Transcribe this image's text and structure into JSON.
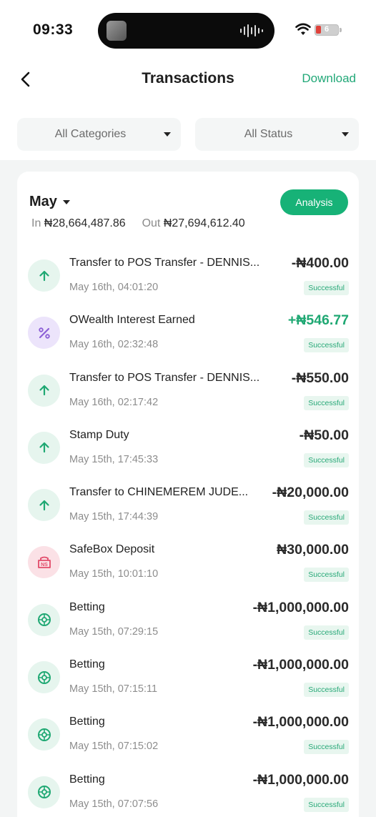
{
  "status_bar": {
    "time": "09:33",
    "battery": "6"
  },
  "nav": {
    "title": "Transactions",
    "download": "Download"
  },
  "filters": {
    "category": "All Categories",
    "status": "All Status"
  },
  "summary": {
    "month": "May",
    "in_label": "In",
    "in_value": "₦28,664,487.86",
    "out_label": "Out",
    "out_value": "₦27,694,612.40",
    "analysis": "Analysis"
  },
  "colors": {
    "accent": "#17b277",
    "positive": "#1fa873",
    "icon_green": "#1fa873",
    "icon_purple": "#8b5fd6",
    "icon_red": "#e24b6a"
  },
  "transactions": [
    {
      "icon": "arrow-up-icon",
      "kind": "out",
      "title": "Transfer to POS Transfer - DENNIS...",
      "date": "May 16th, 04:01:20",
      "amount": "-₦400.00",
      "positive": false,
      "status": "Successful"
    },
    {
      "icon": "percent-icon",
      "kind": "interest",
      "title": "OWealth Interest Earned",
      "date": "May 16th, 02:32:48",
      "amount": "+₦546.77",
      "positive": true,
      "status": "Successful"
    },
    {
      "icon": "arrow-up-icon",
      "kind": "out",
      "title": "Transfer to POS Transfer - DENNIS...",
      "date": "May 16th, 02:17:42",
      "amount": "-₦550.00",
      "positive": false,
      "status": "Successful"
    },
    {
      "icon": "arrow-up-icon",
      "kind": "out",
      "title": "Stamp Duty",
      "date": "May 15th, 17:45:33",
      "amount": "-₦50.00",
      "positive": false,
      "status": "Successful"
    },
    {
      "icon": "arrow-up-icon",
      "kind": "out",
      "title": "Transfer to CHINEMEREM JUDE...",
      "date": "May 15th, 17:44:39",
      "amount": "-₦20,000.00",
      "positive": false,
      "status": "Successful"
    },
    {
      "icon": "safebox-icon",
      "kind": "safebox",
      "title": "SafeBox Deposit",
      "date": "May 15th, 10:01:10",
      "amount": "₦30,000.00",
      "positive": false,
      "status": "Successful"
    },
    {
      "icon": "betting-icon",
      "kind": "bet",
      "title": "Betting",
      "date": "May 15th, 07:29:15",
      "amount": "-₦1,000,000.00",
      "positive": false,
      "status": "Successful"
    },
    {
      "icon": "betting-icon",
      "kind": "bet",
      "title": "Betting",
      "date": "May 15th, 07:15:11",
      "amount": "-₦1,000,000.00",
      "positive": false,
      "status": "Successful"
    },
    {
      "icon": "betting-icon",
      "kind": "bet",
      "title": "Betting",
      "date": "May 15th, 07:15:02",
      "amount": "-₦1,000,000.00",
      "positive": false,
      "status": "Successful"
    },
    {
      "icon": "betting-icon",
      "kind": "bet",
      "title": "Betting",
      "date": "May 15th, 07:07:56",
      "amount": "-₦1,000,000.00",
      "positive": false,
      "status": "Successful"
    }
  ]
}
